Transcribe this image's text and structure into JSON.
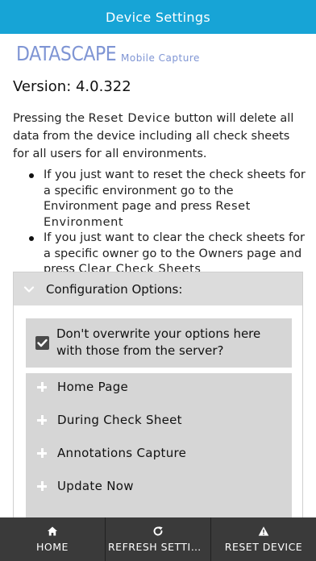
{
  "header": {
    "title": "Device Settings"
  },
  "logo": {
    "brand": "DATASCAPE",
    "tagline": "Mobile Capture"
  },
  "version": "Version: 4.0.322",
  "intro": {
    "before": "Pressing the ",
    "keyword": "Reset Device",
    "after": " button will delete all data from the device including all check sheets for all users for all environments."
  },
  "bullets": [
    {
      "text": "If you just want to reset the check sheets for a specific environment go to the Environment page and press ",
      "keyword": "Reset Environment"
    },
    {
      "text": "If you just want to clear the check sheets for a specific owner go to the Owners page and press ",
      "keyword": "Clear Check Sheets"
    }
  ],
  "config": {
    "title": "Configuration Options:",
    "expanded": true,
    "checkbox_label": "Don't overwrite your options here with those from the server?",
    "checkbox_checked": true,
    "sections": [
      "Home Page",
      "During Check Sheet",
      "Annotations Capture",
      "Update Now"
    ]
  },
  "footer": {
    "tabs": [
      {
        "label": "HOME",
        "icon": "home-icon"
      },
      {
        "label": "REFRESH SETTIN...",
        "icon": "refresh-icon"
      },
      {
        "label": "RESET DEVICE",
        "icon": "warning-icon"
      }
    ]
  },
  "colors": {
    "header": "#17a4d6",
    "logo": "#7f95d4",
    "footer": "#3a3a3a",
    "panel": "#d6d6d6"
  }
}
